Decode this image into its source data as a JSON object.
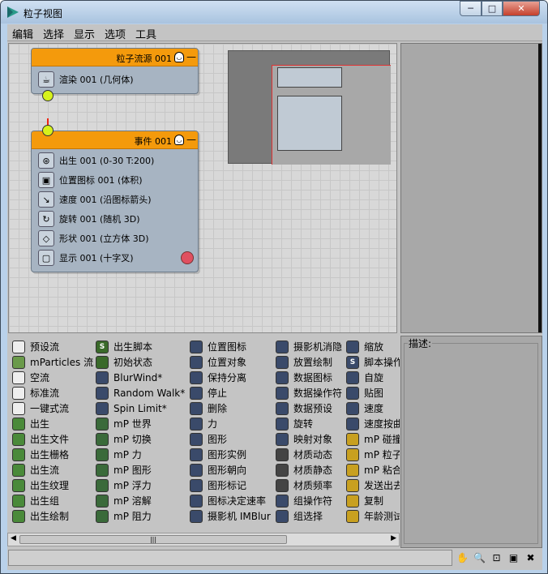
{
  "window": {
    "title": "粒子视图",
    "controls": {
      "minimize": "─",
      "maximize": "□",
      "close": "✕"
    }
  },
  "menu": [
    "编辑",
    "选择",
    "显示",
    "选项",
    "工具"
  ],
  "graph": {
    "source_node": {
      "header": "粒子流源 001",
      "operators": [
        {
          "label": "渲染 001 (几何体)",
          "icon": "teapot-icon"
        }
      ]
    },
    "event_node": {
      "header": "事件 001",
      "operators": [
        {
          "label": "出生 001 (0-30 T:200)",
          "icon": "birth-icon"
        },
        {
          "label": "位置图标 001 (体积)",
          "icon": "position-icon"
        },
        {
          "label": "速度 001 (沿图标箭头)",
          "icon": "speed-icon"
        },
        {
          "label": "旋转 001 (随机 3D)",
          "icon": "rotation-icon"
        },
        {
          "label": "形状 001 (立方体 3D)",
          "icon": "shape-icon"
        },
        {
          "label": "显示 001 (十字叉)",
          "icon": "display-icon"
        }
      ]
    },
    "colors": {
      "header": "#f49a0c",
      "node_body": "#a7b4c2",
      "connector": "#d7f21c",
      "wire": "#ee2211"
    }
  },
  "depot": {
    "columns": [
      [
        {
          "label": "预设流",
          "color": "#eeeeee"
        },
        {
          "label": "mParticles 流",
          "color": "#6a9a4a"
        },
        {
          "label": "空流",
          "color": "#eeeeee"
        },
        {
          "label": "标准流",
          "color": "#eeeeee"
        },
        {
          "label": "一键式流",
          "color": "#eeeeee"
        },
        {
          "label": "出生",
          "color": "#4a8a3a"
        },
        {
          "label": "出生文件",
          "color": "#4a8a3a"
        },
        {
          "label": "出生栅格",
          "color": "#4a8a3a"
        },
        {
          "label": "出生流",
          "color": "#4a8a3a"
        },
        {
          "label": "出生纹理",
          "color": "#4a8a3a"
        },
        {
          "label": "出生组",
          "color": "#4a8a3a"
        },
        {
          "label": "出生绘制",
          "color": "#4a8a3a"
        }
      ],
      [
        {
          "label": "出生脚本",
          "color": "#3a6a2a",
          "glyph": "S"
        },
        {
          "label": "初始状态",
          "color": "#3a6a2a"
        },
        {
          "label": "BlurWind*",
          "color": "#3a4a6a"
        },
        {
          "label": "Random Walk*",
          "color": "#3a4a6a"
        },
        {
          "label": "Spin Limit*",
          "color": "#3a4a6a"
        },
        {
          "label": "mP 世界",
          "color": "#3a6a3a"
        },
        {
          "label": "mP 切换",
          "color": "#3a6a3a"
        },
        {
          "label": "mP 力",
          "color": "#3a6a3a"
        },
        {
          "label": "mP 图形",
          "color": "#3a6a3a"
        },
        {
          "label": "mP 浮力",
          "color": "#3a6a3a"
        },
        {
          "label": "mP 溶解",
          "color": "#3a6a3a"
        },
        {
          "label": "mP 阻力",
          "color": "#3a6a3a"
        }
      ],
      [
        {
          "label": "位置图标",
          "color": "#3a4a6a"
        },
        {
          "label": "位置对象",
          "color": "#3a4a6a"
        },
        {
          "label": "保持分离",
          "color": "#3a4a6a"
        },
        {
          "label": "停止",
          "color": "#3a4a6a"
        },
        {
          "label": "删除",
          "color": "#3a4a6a"
        },
        {
          "label": "力",
          "color": "#3a4a6a"
        },
        {
          "label": "图形",
          "color": "#3a4a6a"
        },
        {
          "label": "图形实例",
          "color": "#3a4a6a"
        },
        {
          "label": "图形朝向",
          "color": "#3a4a6a"
        },
        {
          "label": "图形标记",
          "color": "#3a4a6a"
        },
        {
          "label": "图标决定速率",
          "color": "#3a4a6a"
        },
        {
          "label": "摄影机 IMBlur",
          "color": "#3a4a6a"
        }
      ],
      [
        {
          "label": "摄影机消隐",
          "color": "#3a4a6a"
        },
        {
          "label": "放置绘制",
          "color": "#3a4a6a"
        },
        {
          "label": "数据图标",
          "color": "#3a4a6a"
        },
        {
          "label": "数据操作符",
          "color": "#3a4a6a"
        },
        {
          "label": "数据预设",
          "color": "#3a4a6a"
        },
        {
          "label": "旋转",
          "color": "#3a4a6a"
        },
        {
          "label": "映射对象",
          "color": "#3a4a6a"
        },
        {
          "label": "材质动态",
          "color": "#444444"
        },
        {
          "label": "材质静态",
          "color": "#444444"
        },
        {
          "label": "材质频率",
          "color": "#444444"
        },
        {
          "label": "组操作符",
          "color": "#3a4a6a"
        },
        {
          "label": "组选择",
          "color": "#3a4a6a"
        }
      ],
      [
        {
          "label": "缩放",
          "color": "#3a4a6a"
        },
        {
          "label": "脚本操作",
          "color": "#3a4a6a",
          "glyph": "S"
        },
        {
          "label": "自旋",
          "color": "#3a4a6a"
        },
        {
          "label": "贴图",
          "color": "#3a4a6a"
        },
        {
          "label": "速度",
          "color": "#3a4a6a"
        },
        {
          "label": "速度按曲",
          "color": "#3a4a6a"
        },
        {
          "label": "mP 碰撞",
          "color": "#c8a020"
        },
        {
          "label": "mP 粒子",
          "color": "#c8a020"
        },
        {
          "label": "mP 粘合",
          "color": "#c8a020"
        },
        {
          "label": "发送出去",
          "color": "#c8a020"
        },
        {
          "label": "复制",
          "color": "#c8a020"
        },
        {
          "label": "年龄测试",
          "color": "#c8a020"
        }
      ]
    ]
  },
  "description": {
    "label": "描述:"
  },
  "scrollbar": {
    "grip": "|||",
    "left": "◀",
    "right": "▶"
  },
  "status_tools": [
    {
      "name": "pan-icon",
      "glyph": "✋"
    },
    {
      "name": "zoom-icon",
      "glyph": "🔍"
    },
    {
      "name": "zoom-region-icon",
      "glyph": "⊡"
    },
    {
      "name": "zoom-extents-icon",
      "glyph": "▣"
    },
    {
      "name": "no-zoom-icon",
      "glyph": "✖"
    }
  ]
}
